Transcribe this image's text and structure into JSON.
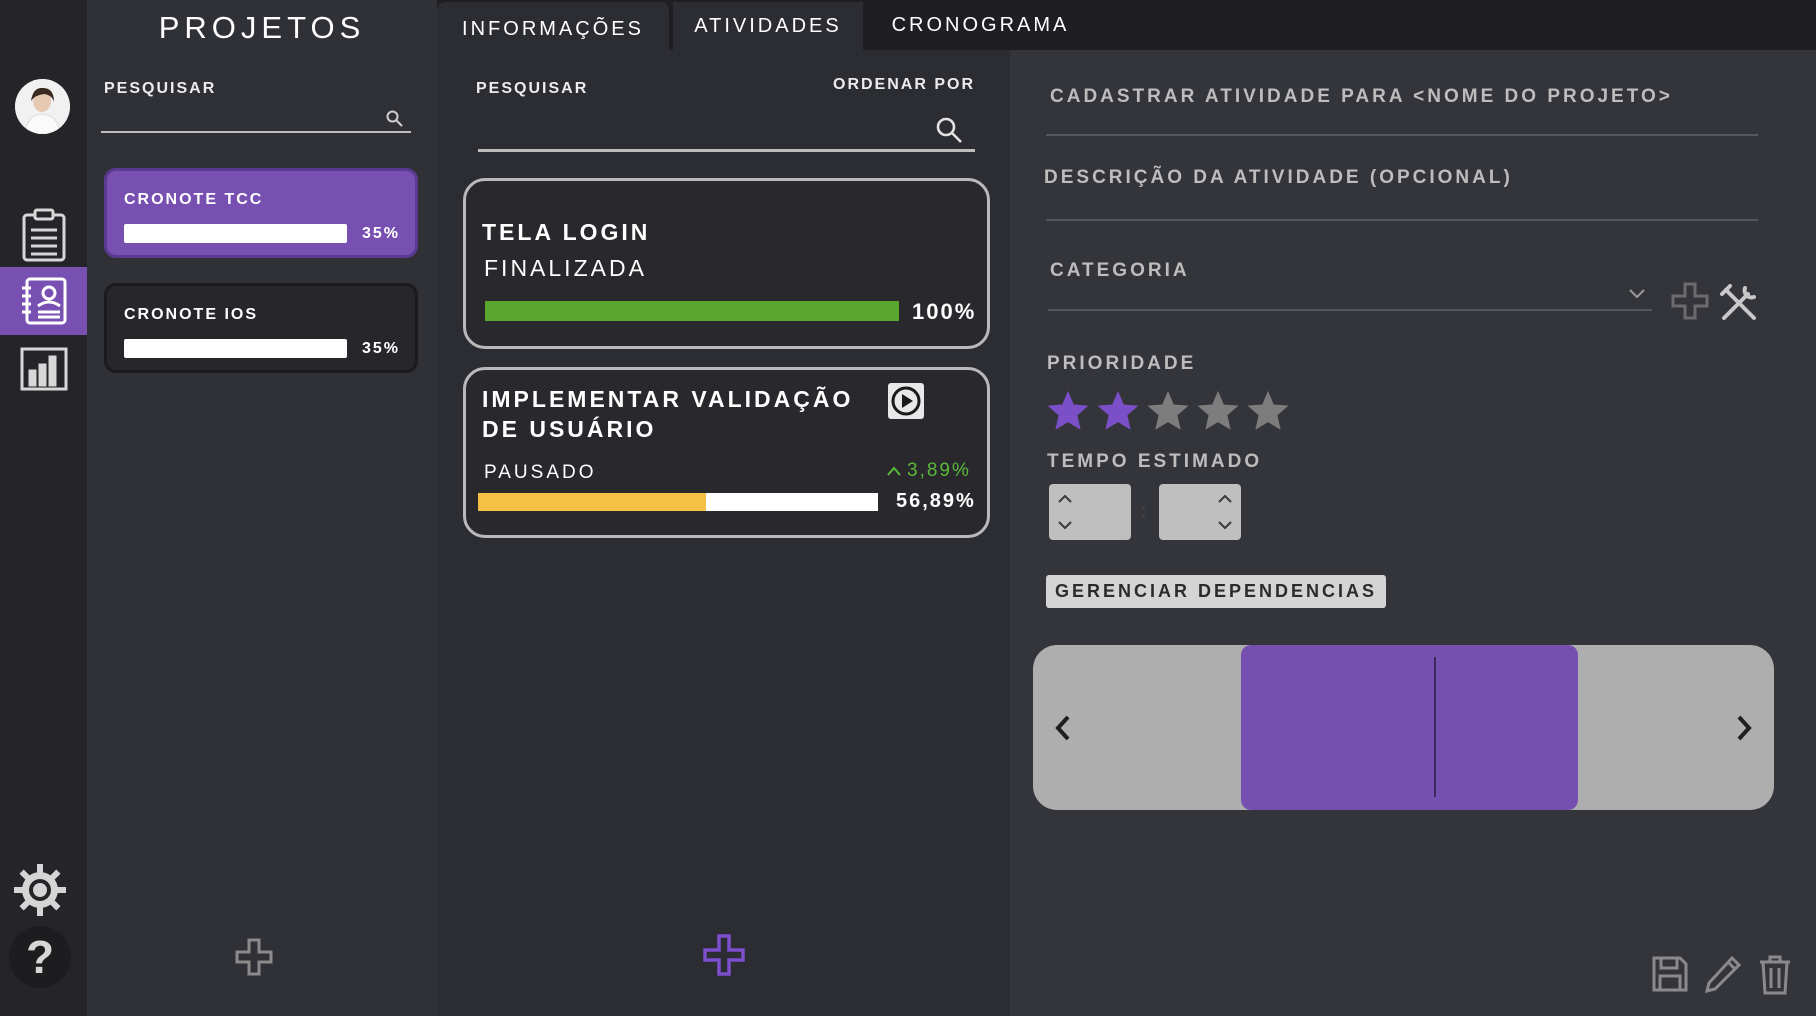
{
  "projects": {
    "title": "PROJETOS",
    "search_label": "PESQUISAR",
    "items": [
      {
        "name": "CRONOTE TCC",
        "progress_pct": 35,
        "progress_label": "35%",
        "active": true
      },
      {
        "name": "CRONOTE IOS",
        "progress_pct": 35,
        "progress_label": "35%",
        "active": false
      }
    ]
  },
  "tabs": [
    "INFORMAÇÕES",
    "ATIVIDADES",
    "CRONOGRAMA"
  ],
  "activities": {
    "search_label": "PESQUISAR",
    "sort_label": "ORDENAR POR",
    "items": [
      {
        "title": "TELA LOGIN",
        "status": "FINALIZADA",
        "progress_pct": 100,
        "progress_label": "100%",
        "bar_color": "#5aa631"
      },
      {
        "title_line1": "IMPLEMENTAR VALIDAÇÃO",
        "title_line2": "DE USUÁRIO",
        "status": "PAUSADO",
        "delta": "3,89%",
        "progress_pct": 56.89,
        "progress_label": "56,89%",
        "bar_color": "#f4c144",
        "delta_color": "#5ab93a"
      }
    ]
  },
  "form": {
    "title": "CADASTRAR ATIVIDADE PARA <NOME DO PROJETO>",
    "description_label": "DESCRIÇÃO DA ATIVIDADE (OPCIONAL)",
    "category_label": "CATEGORIA",
    "priority_label": "PRIORIDADE",
    "priority_value": 2,
    "priority_max": 5,
    "time_label": "TEMPO ESTIMADO",
    "time_separator": ":",
    "dependencies_button": "GERENCIAR DEPENDENCIAS"
  },
  "colors": {
    "accent": "#7750b2",
    "star_active": "#7a4fc7",
    "star_inactive": "#7d7d7d"
  },
  "icons": [
    "clipboard-icon",
    "contacts-icon",
    "bar-chart-icon",
    "gear-icon",
    "help-icon",
    "search-icon",
    "play-icon",
    "plus-icon",
    "tools-icon",
    "save-icon",
    "edit-icon",
    "trash-icon",
    "chevron-left-icon",
    "chevron-right-icon"
  ]
}
